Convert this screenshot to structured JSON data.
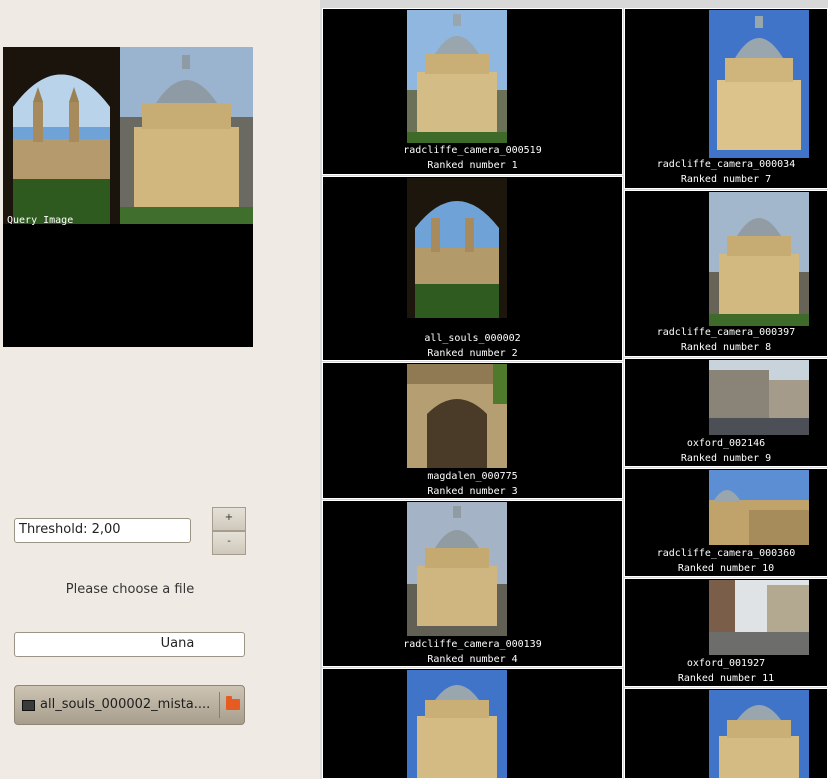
{
  "query": {
    "label": "Query Image"
  },
  "controls": {
    "threshold_value": "Threshold: 2,00",
    "plus_label": "+",
    "minus_label": "-",
    "choose_file_label": "Please choose a file",
    "name_value": "Uana",
    "selected_file": "all_souls_000002_mista....",
    "file_icon": "file-icon",
    "folder_icon": "folder-open-icon"
  },
  "results": [
    {
      "name": "radcliffe_camera_000519",
      "rank": "Ranked number 1",
      "image": "radcliffe-dome"
    },
    {
      "name": "all_souls_000002",
      "rank": "Ranked number 2",
      "image": "arch-view"
    },
    {
      "name": "magdalen_000775",
      "rank": "Ranked number 3",
      "image": "gate"
    },
    {
      "name": "radcliffe_camera_000139",
      "rank": "Ranked number 4",
      "image": "radcliffe-dome"
    },
    {
      "name": "",
      "rank": "",
      "image": "radcliffe-dome"
    },
    {
      "name": "radcliffe_camera_000034",
      "rank": "Ranked number 7",
      "image": "radcliffe-dome"
    },
    {
      "name": "radcliffe_camera_000397",
      "rank": "Ranked number 8",
      "image": "radcliffe-dome"
    },
    {
      "name": "oxford_002146",
      "rank": "Ranked number 9",
      "image": "street"
    },
    {
      "name": "radcliffe_camera_000360",
      "rank": "Ranked number 10",
      "image": "radcliffe-aerial"
    },
    {
      "name": "oxford_001927",
      "rank": "Ranked number 11",
      "image": "street"
    },
    {
      "name": "",
      "rank": "",
      "image": "radcliffe-dome"
    }
  ]
}
